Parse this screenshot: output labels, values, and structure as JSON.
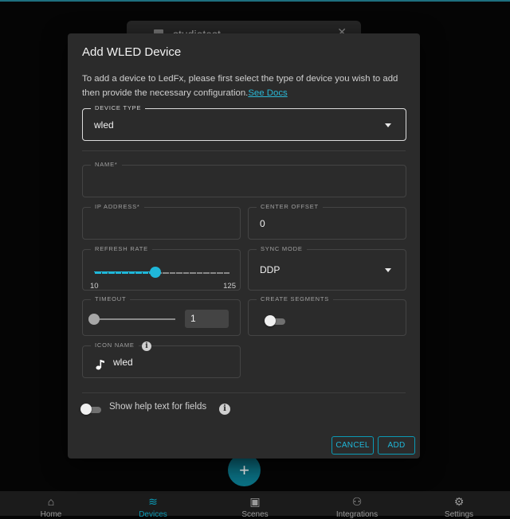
{
  "background": {
    "card_title": "studiotest",
    "fab_label": "+",
    "nav": [
      {
        "label": "Home",
        "icon": "home-icon",
        "glyph": "⌂",
        "active": false
      },
      {
        "label": "Devices",
        "icon": "devices-icon",
        "glyph": "≋",
        "active": true
      },
      {
        "label": "Scenes",
        "icon": "image-icon",
        "glyph": "▣",
        "active": false
      },
      {
        "label": "Integrations",
        "icon": "integrations-icon",
        "glyph": "⚇",
        "active": false
      },
      {
        "label": "Settings",
        "icon": "settings-icon",
        "glyph": "⚙",
        "active": false
      }
    ]
  },
  "dialog": {
    "title": "Add WLED Device",
    "description": "To add a device to LedFx, please first select the type of device you wish to add then provide the necessary configuration.",
    "docs_link": "See Docs",
    "device_type": {
      "label": "DEVICE TYPE",
      "value": "wled"
    },
    "name": {
      "label": "NAME*",
      "value": ""
    },
    "ip_address": {
      "label": "IP ADDRESS*",
      "value": ""
    },
    "center_offset": {
      "label": "CENTER OFFSET",
      "value": "0"
    },
    "refresh_rate": {
      "label": "REFRESH RATE",
      "min": "10",
      "max": "125",
      "value_fraction": 0.45
    },
    "sync_mode": {
      "label": "SYNC MODE",
      "value": "DDP"
    },
    "timeout": {
      "label": "TIMEOUT",
      "value": "1",
      "value_fraction": 0.0
    },
    "create_segments": {
      "label": "CREATE SEGMENTS",
      "checked": false
    },
    "icon_name": {
      "label": "ICON NAME",
      "value": "wled"
    },
    "help_toggle": {
      "label": "Show help text for fields",
      "checked": false
    },
    "buttons": {
      "cancel": "CANCEL",
      "add": "ADD"
    }
  },
  "colors": {
    "accent": "#1fb7d9",
    "dialog_bg": "#2b2b2b",
    "page_bg": "#050505"
  }
}
